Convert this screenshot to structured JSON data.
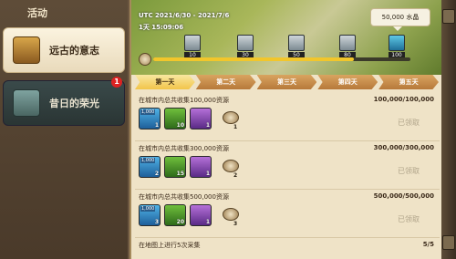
{
  "sidebar": {
    "title": "活动",
    "items": [
      {
        "label": "远古的意志",
        "icon": "treasure-chest-icon"
      },
      {
        "label": "昔日的荣光",
        "icon": "tower-icon",
        "badge": "1"
      }
    ]
  },
  "banner": {
    "date_range": "UTC 2021/6/30 - 2021/7/6",
    "time_left": "1天 15:09:06",
    "reward": "50,000 水晶",
    "milestones": [
      "10",
      "30",
      "50",
      "80",
      "100"
    ],
    "progress": 0.78
  },
  "days": [
    "第一天",
    "第二天",
    "第三天",
    "第四天",
    "第五天"
  ],
  "tasks": [
    {
      "title": "在城市内总共收集100,000资源",
      "progress": "100,000/100,000",
      "status": "已领取",
      "items": [
        {
          "type": "blue",
          "badge": "1,000",
          "count": "1"
        },
        {
          "type": "green",
          "count": "10"
        },
        {
          "type": "purple",
          "count": "1"
        }
      ],
      "stone_count": "1"
    },
    {
      "title": "在城市内总共收集300,000资源",
      "progress": "300,000/300,000",
      "status": "已领取",
      "items": [
        {
          "type": "blue",
          "badge": "1,000",
          "count": "2"
        },
        {
          "type": "green",
          "count": "15"
        },
        {
          "type": "purple",
          "count": "1"
        }
      ],
      "stone_count": "2"
    },
    {
      "title": "在城市内总共收集500,000资源",
      "progress": "500,000/500,000",
      "status": "已领取",
      "items": [
        {
          "type": "blue",
          "badge": "1,000",
          "count": "3"
        },
        {
          "type": "green",
          "count": "20"
        },
        {
          "type": "purple",
          "count": "1"
        }
      ],
      "stone_count": "3"
    },
    {
      "title": "在地图上进行5次采集",
      "progress": "5/5",
      "items": []
    }
  ]
}
